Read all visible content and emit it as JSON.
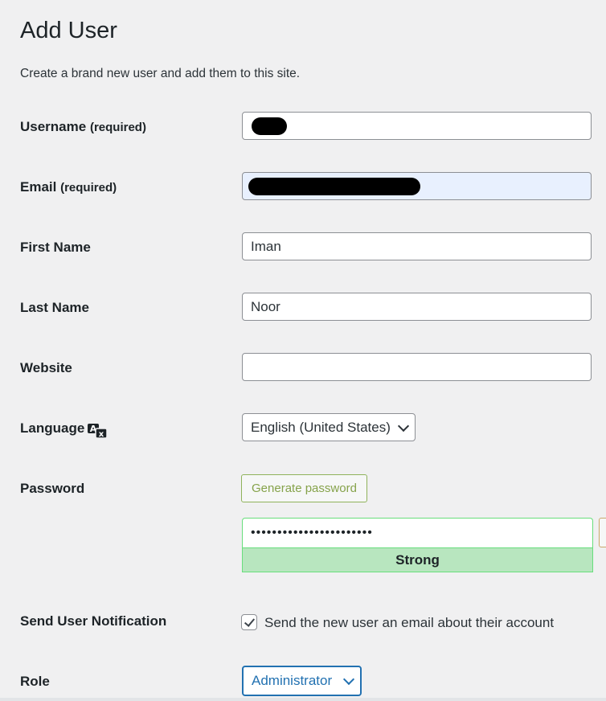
{
  "page": {
    "title": "Add User",
    "description": "Create a brand new user and add them to this site."
  },
  "form": {
    "username": {
      "label": "Username",
      "required_note": "(required)",
      "value": ""
    },
    "email": {
      "label": "Email",
      "required_note": "(required)",
      "value": ""
    },
    "first_name": {
      "label": "First Name",
      "value": "Iman"
    },
    "last_name": {
      "label": "Last Name",
      "value": "Noor"
    },
    "website": {
      "label": "Website",
      "value": ""
    },
    "language": {
      "label": "Language",
      "icon": "translate-icon",
      "selected": "English (United States)"
    },
    "password": {
      "label": "Password",
      "generate_button": "Generate password",
      "value": "•••••••••••••••••••••••",
      "strength": "Strong"
    },
    "notification": {
      "label": "Send User Notification",
      "checkbox_label": "Send the new user an email about their account",
      "checked": true
    },
    "role": {
      "label": "Role",
      "selected": "Administrator"
    }
  },
  "colors": {
    "accent": "#2271b1",
    "strength_bg": "#b8e6bf",
    "strength_border": "#68de7c",
    "autofill_bg": "#e8f0fe"
  }
}
